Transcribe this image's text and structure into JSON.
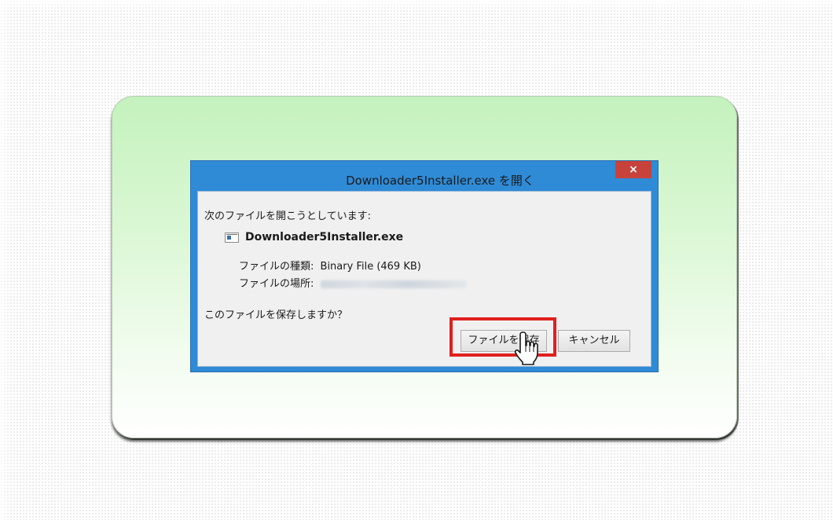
{
  "dialog": {
    "title": "Downloader5Installer.exe を開く",
    "close_label": "×",
    "prompt": "次のファイルを開こうとしています:",
    "file_name": "Downloader5Installer.exe",
    "type_label": "ファイルの種類:",
    "type_value": "Binary File (469 KB)",
    "location_label": "ファイルの場所:",
    "question": "このファイルを保存しますか？",
    "save_button": "ファイルを保存",
    "cancel_button": "キャンセル"
  },
  "colors": {
    "highlight": "#e0201d",
    "title_bar": "#2f8bd6",
    "close_button": "#c7423b"
  },
  "icons": [
    "file-icon",
    "close-icon",
    "hand-cursor-icon"
  ]
}
